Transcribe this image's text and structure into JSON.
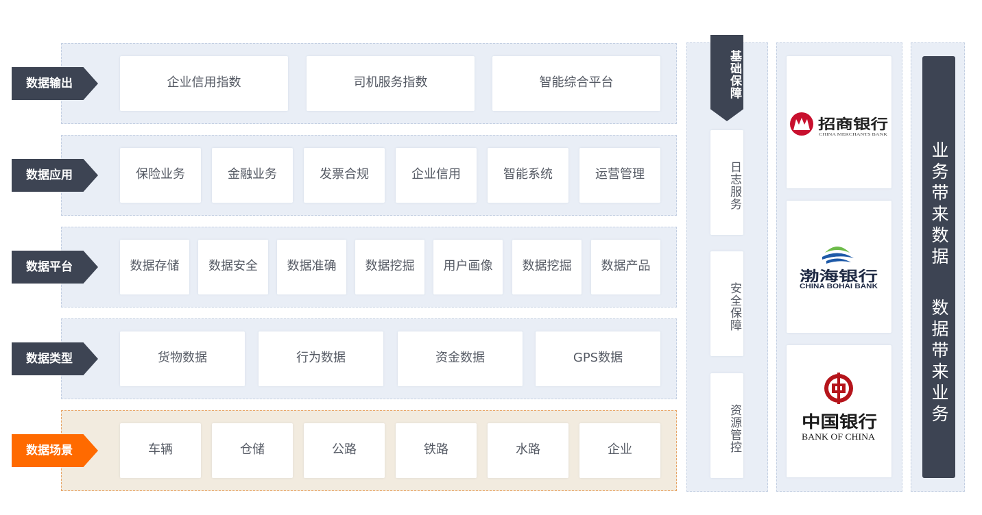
{
  "rows": [
    {
      "tag": "数据输出",
      "items": [
        "企业信用指数",
        "司机服务指数",
        "智能综合平台"
      ]
    },
    {
      "tag": "数据应用",
      "items": [
        "保险业务",
        "金融业务",
        "发票合规",
        "企业信用",
        "智能系统",
        "运营管理"
      ]
    },
    {
      "tag": "数据平台",
      "items": [
        "数据存储",
        "数据安全",
        "数据准确",
        "数据挖掘",
        "用户画像",
        "数据挖掘",
        "数据产品"
      ]
    },
    {
      "tag": "数据类型",
      "items": [
        "货物数据",
        "行为数据",
        "资金数据",
        "GPS数据"
      ]
    },
    {
      "tag": "数据场景",
      "items": [
        "车辆",
        "仓储",
        "公路",
        "铁路",
        "水路",
        "企业"
      ]
    }
  ],
  "foundation": {
    "title": "基础保障",
    "items": [
      "日志服务",
      "安全保障",
      "资源管控"
    ]
  },
  "banks": [
    {
      "name": "招商银行",
      "en": "CHINA MERCHANTS BANK"
    },
    {
      "name": "渤海银行",
      "en": "CHINA BOHAI BANK"
    },
    {
      "name": "中国银行",
      "en": "BANK OF CHINA"
    }
  ],
  "slogan": {
    "line1": "业务带来数据",
    "line2": "数据带来业务"
  },
  "colors": {
    "dark": "#3d4453",
    "accent": "#ff6a00",
    "band": "#e9eef6",
    "scene_band": "#f2ebdf",
    "cmb_red": "#c8102e",
    "boc_red": "#b5141b",
    "bohai_blue": "#1e5aa8",
    "bohai_green": "#6dbb4a"
  }
}
